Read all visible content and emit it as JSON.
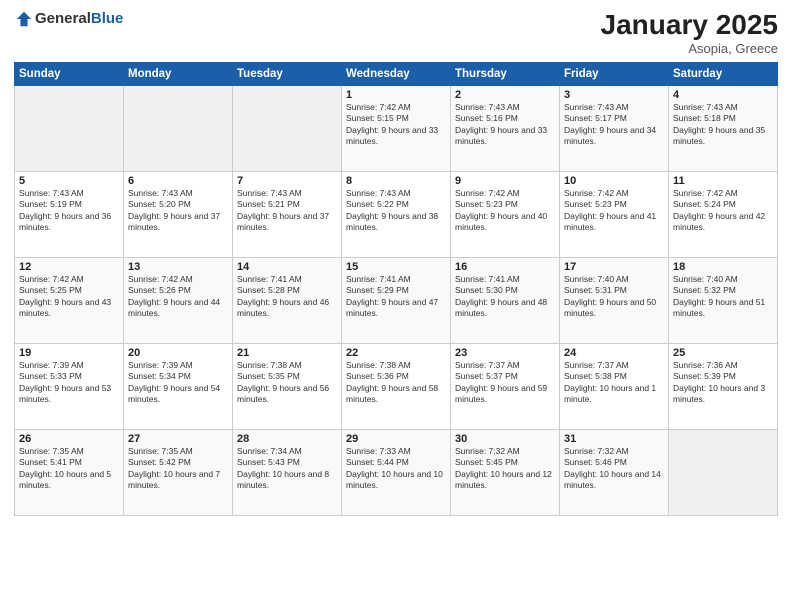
{
  "logo": {
    "general": "General",
    "blue": "Blue"
  },
  "header": {
    "month": "January 2025",
    "location": "Asopia, Greece"
  },
  "weekdays": [
    "Sunday",
    "Monday",
    "Tuesday",
    "Wednesday",
    "Thursday",
    "Friday",
    "Saturday"
  ],
  "weeks": [
    [
      {
        "day": "",
        "sunrise": "",
        "sunset": "",
        "daylight": ""
      },
      {
        "day": "",
        "sunrise": "",
        "sunset": "",
        "daylight": ""
      },
      {
        "day": "",
        "sunrise": "",
        "sunset": "",
        "daylight": ""
      },
      {
        "day": "1",
        "sunrise": "Sunrise: 7:42 AM",
        "sunset": "Sunset: 5:15 PM",
        "daylight": "Daylight: 9 hours and 33 minutes."
      },
      {
        "day": "2",
        "sunrise": "Sunrise: 7:43 AM",
        "sunset": "Sunset: 5:16 PM",
        "daylight": "Daylight: 9 hours and 33 minutes."
      },
      {
        "day": "3",
        "sunrise": "Sunrise: 7:43 AM",
        "sunset": "Sunset: 5:17 PM",
        "daylight": "Daylight: 9 hours and 34 minutes."
      },
      {
        "day": "4",
        "sunrise": "Sunrise: 7:43 AM",
        "sunset": "Sunset: 5:18 PM",
        "daylight": "Daylight: 9 hours and 35 minutes."
      }
    ],
    [
      {
        "day": "5",
        "sunrise": "Sunrise: 7:43 AM",
        "sunset": "Sunset: 5:19 PM",
        "daylight": "Daylight: 9 hours and 36 minutes."
      },
      {
        "day": "6",
        "sunrise": "Sunrise: 7:43 AM",
        "sunset": "Sunset: 5:20 PM",
        "daylight": "Daylight: 9 hours and 37 minutes."
      },
      {
        "day": "7",
        "sunrise": "Sunrise: 7:43 AM",
        "sunset": "Sunset: 5:21 PM",
        "daylight": "Daylight: 9 hours and 37 minutes."
      },
      {
        "day": "8",
        "sunrise": "Sunrise: 7:43 AM",
        "sunset": "Sunset: 5:22 PM",
        "daylight": "Daylight: 9 hours and 38 minutes."
      },
      {
        "day": "9",
        "sunrise": "Sunrise: 7:42 AM",
        "sunset": "Sunset: 5:23 PM",
        "daylight": "Daylight: 9 hours and 40 minutes."
      },
      {
        "day": "10",
        "sunrise": "Sunrise: 7:42 AM",
        "sunset": "Sunset: 5:23 PM",
        "daylight": "Daylight: 9 hours and 41 minutes."
      },
      {
        "day": "11",
        "sunrise": "Sunrise: 7:42 AM",
        "sunset": "Sunset: 5:24 PM",
        "daylight": "Daylight: 9 hours and 42 minutes."
      }
    ],
    [
      {
        "day": "12",
        "sunrise": "Sunrise: 7:42 AM",
        "sunset": "Sunset: 5:25 PM",
        "daylight": "Daylight: 9 hours and 43 minutes."
      },
      {
        "day": "13",
        "sunrise": "Sunrise: 7:42 AM",
        "sunset": "Sunset: 5:26 PM",
        "daylight": "Daylight: 9 hours and 44 minutes."
      },
      {
        "day": "14",
        "sunrise": "Sunrise: 7:41 AM",
        "sunset": "Sunset: 5:28 PM",
        "daylight": "Daylight: 9 hours and 46 minutes."
      },
      {
        "day": "15",
        "sunrise": "Sunrise: 7:41 AM",
        "sunset": "Sunset: 5:29 PM",
        "daylight": "Daylight: 9 hours and 47 minutes."
      },
      {
        "day": "16",
        "sunrise": "Sunrise: 7:41 AM",
        "sunset": "Sunset: 5:30 PM",
        "daylight": "Daylight: 9 hours and 48 minutes."
      },
      {
        "day": "17",
        "sunrise": "Sunrise: 7:40 AM",
        "sunset": "Sunset: 5:31 PM",
        "daylight": "Daylight: 9 hours and 50 minutes."
      },
      {
        "day": "18",
        "sunrise": "Sunrise: 7:40 AM",
        "sunset": "Sunset: 5:32 PM",
        "daylight": "Daylight: 9 hours and 51 minutes."
      }
    ],
    [
      {
        "day": "19",
        "sunrise": "Sunrise: 7:39 AM",
        "sunset": "Sunset: 5:33 PM",
        "daylight": "Daylight: 9 hours and 53 minutes."
      },
      {
        "day": "20",
        "sunrise": "Sunrise: 7:39 AM",
        "sunset": "Sunset: 5:34 PM",
        "daylight": "Daylight: 9 hours and 54 minutes."
      },
      {
        "day": "21",
        "sunrise": "Sunrise: 7:38 AM",
        "sunset": "Sunset: 5:35 PM",
        "daylight": "Daylight: 9 hours and 56 minutes."
      },
      {
        "day": "22",
        "sunrise": "Sunrise: 7:38 AM",
        "sunset": "Sunset: 5:36 PM",
        "daylight": "Daylight: 9 hours and 58 minutes."
      },
      {
        "day": "23",
        "sunrise": "Sunrise: 7:37 AM",
        "sunset": "Sunset: 5:37 PM",
        "daylight": "Daylight: 9 hours and 59 minutes."
      },
      {
        "day": "24",
        "sunrise": "Sunrise: 7:37 AM",
        "sunset": "Sunset: 5:38 PM",
        "daylight": "Daylight: 10 hours and 1 minute."
      },
      {
        "day": "25",
        "sunrise": "Sunrise: 7:36 AM",
        "sunset": "Sunset: 5:39 PM",
        "daylight": "Daylight: 10 hours and 3 minutes."
      }
    ],
    [
      {
        "day": "26",
        "sunrise": "Sunrise: 7:35 AM",
        "sunset": "Sunset: 5:41 PM",
        "daylight": "Daylight: 10 hours and 5 minutes."
      },
      {
        "day": "27",
        "sunrise": "Sunrise: 7:35 AM",
        "sunset": "Sunset: 5:42 PM",
        "daylight": "Daylight: 10 hours and 7 minutes."
      },
      {
        "day": "28",
        "sunrise": "Sunrise: 7:34 AM",
        "sunset": "Sunset: 5:43 PM",
        "daylight": "Daylight: 10 hours and 8 minutes."
      },
      {
        "day": "29",
        "sunrise": "Sunrise: 7:33 AM",
        "sunset": "Sunset: 5:44 PM",
        "daylight": "Daylight: 10 hours and 10 minutes."
      },
      {
        "day": "30",
        "sunrise": "Sunrise: 7:32 AM",
        "sunset": "Sunset: 5:45 PM",
        "daylight": "Daylight: 10 hours and 12 minutes."
      },
      {
        "day": "31",
        "sunrise": "Sunrise: 7:32 AM",
        "sunset": "Sunset: 5:46 PM",
        "daylight": "Daylight: 10 hours and 14 minutes."
      },
      {
        "day": "",
        "sunrise": "",
        "sunset": "",
        "daylight": ""
      }
    ]
  ]
}
